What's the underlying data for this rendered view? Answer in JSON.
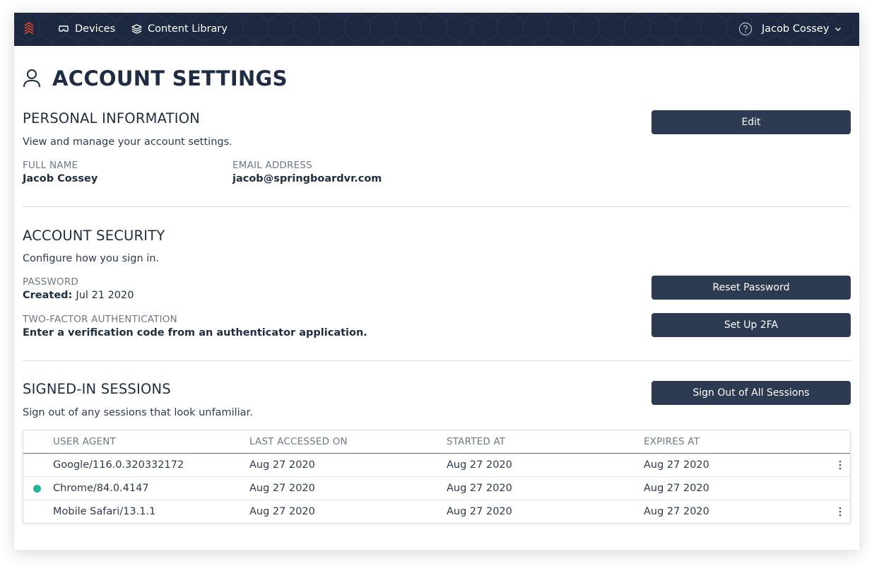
{
  "nav": {
    "items": [
      {
        "label": "Devices",
        "icon": "vr-headset-icon"
      },
      {
        "label": "Content Library",
        "icon": "layers-icon"
      }
    ],
    "user_name": "Jacob Cossey",
    "brand_accent": "#e8462f",
    "bar_color": "#1c2940"
  },
  "page": {
    "title": "ACCOUNT SETTINGS"
  },
  "personal": {
    "title": "PERSONAL INFORMATION",
    "description": "View and manage your account settings.",
    "edit_label": "Edit",
    "full_name_label": "FULL NAME",
    "full_name": "Jacob Cossey",
    "email_label": "EMAIL ADDRESS",
    "email": "jacob@springboardvr.com"
  },
  "security": {
    "title": "ACCOUNT SECURITY",
    "description": "Configure how you sign in.",
    "password_label": "PASSWORD",
    "created_label": "Created:",
    "created_value": "Jul 21 2020",
    "reset_label": "Reset Password",
    "twofa_label": "TWO-FACTOR AUTHENTICATION",
    "twofa_desc": "Enter a verification code from an authenticator application.",
    "twofa_button": "Set Up 2FA"
  },
  "sessions": {
    "title": "SIGNED-IN SESSIONS",
    "description": "Sign out of any sessions that look unfamiliar.",
    "signout_all_label": "Sign Out of All Sessions",
    "columns": [
      "USER AGENT",
      "LAST ACCESSED ON",
      "STARTED AT",
      "EXPIRES AT"
    ],
    "rows": [
      {
        "user_agent": "Google/116.0.320332172",
        "last_accessed": "Aug 27 2020",
        "started": "Aug 27 2020",
        "expires": "Aug 27 2020",
        "current": false,
        "has_menu": true
      },
      {
        "user_agent": "Chrome/84.0.4147",
        "last_accessed": "Aug 27 2020",
        "started": "Aug 27 2020",
        "expires": "Aug 27 2020",
        "current": true,
        "has_menu": false
      },
      {
        "user_agent": "Mobile Safari/13.1.1",
        "last_accessed": "Aug 27 2020",
        "started": "Aug 27 2020",
        "expires": "Aug 27 2020",
        "current": false,
        "has_menu": true
      }
    ],
    "current_dot_color": "#1fb89c"
  }
}
